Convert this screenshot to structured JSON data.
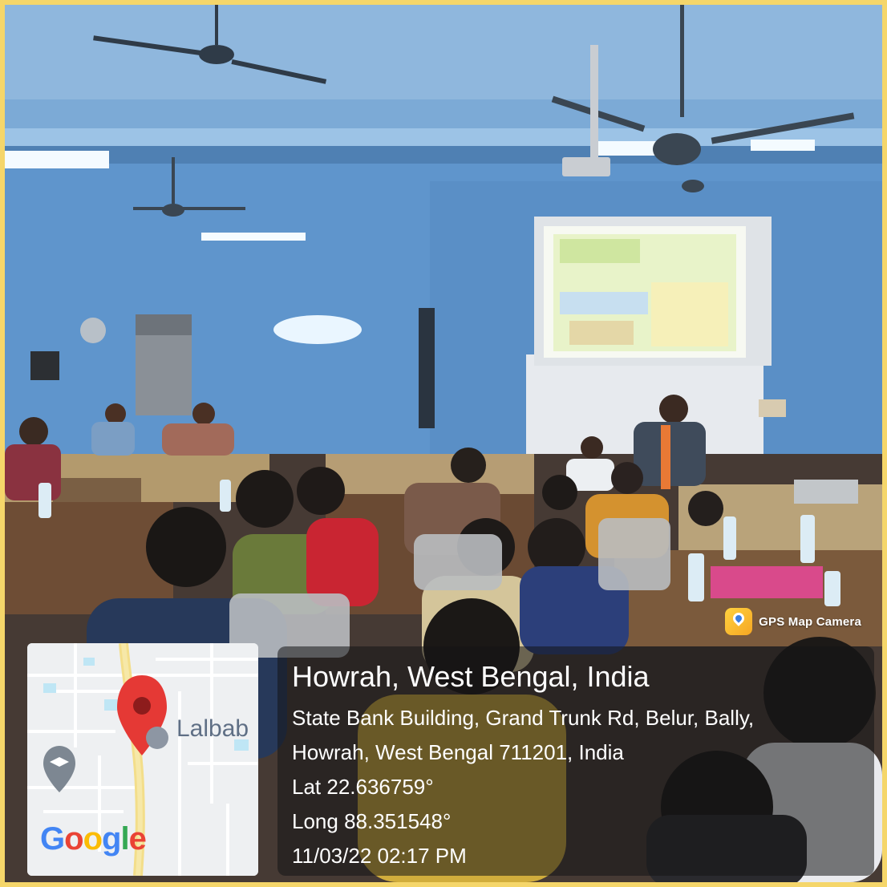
{
  "photo": {
    "description_icon": "classroom-photo"
  },
  "gps_badge": {
    "icon": "gps-map-camera-icon",
    "label": "GPS Map Camera"
  },
  "location": {
    "title": "Howrah, West Bengal, India",
    "address_line_1": "State Bank Building, Grand Trunk Rd, Belur, Bally,",
    "address_line_2": "Howrah, West Bengal 711201, India",
    "lat": "Lat 22.636759°",
    "long": "Long 88.351548°",
    "datetime": "11/03/22 02:17 PM"
  },
  "map": {
    "area_label": "Lalbab",
    "brand": [
      "G",
      "o",
      "o",
      "g",
      "l",
      "e"
    ],
    "pin_color": "#e53935",
    "education_icon": "graduation-cap-icon"
  }
}
